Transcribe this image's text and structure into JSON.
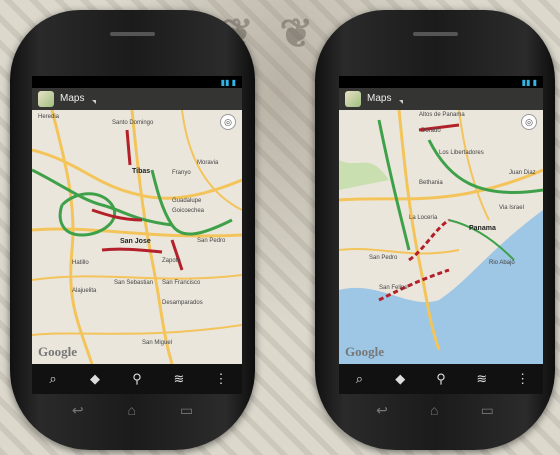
{
  "left_phone": {
    "app_title": "Maps",
    "watermark": "Google",
    "map_labels": {
      "heredia": "Heredia",
      "santo_domingo": "Santo Domingo",
      "tibas": "Tibas",
      "moravia": "Moravia",
      "franyo": "Franyo",
      "goicoechea": "Goicoechea",
      "guadalupe": "Guadalupe",
      "san_jose": "San Jose",
      "san_pedro": "San Pedro",
      "hatillo": "Hatillo",
      "alajuelita": "Alajuelita",
      "san_sebastian": "San Sebastian",
      "san_francisco": "San Francisco",
      "desamparados": "Desamparados",
      "san_miguel": "San Miguel",
      "zapote": "Zapote"
    }
  },
  "right_phone": {
    "app_title": "Maps",
    "watermark": "Google",
    "map_labels": {
      "altos": "Altos de Panama",
      "dorado": "Dorado",
      "los_libertadores": "Los Libertadores",
      "bethania": "Bethania",
      "la_locería": "La Locería",
      "panama": "Panama",
      "san_felipe": "San Felipe",
      "juan_diaz": "Juan Diaz",
      "via_israel": "Via Israel",
      "rio_abajo": "Rio Abajo",
      "san_pedro": "San Pedro"
    }
  },
  "bottom_bar_icons": [
    "search-icon",
    "directions-icon",
    "places-icon",
    "layers-icon",
    "overflow-menu-icon"
  ],
  "nav_icons": [
    "back-icon",
    "home-icon",
    "recent-apps-icon"
  ],
  "colors": {
    "map_bg": "#ebe6dc",
    "road_major": "#f3c45a",
    "traffic_green": "#3ea14a",
    "traffic_red": "#b3202a",
    "water": "#9ec7e6",
    "park": "#c9dfb0",
    "accent": "#33b5e5"
  }
}
